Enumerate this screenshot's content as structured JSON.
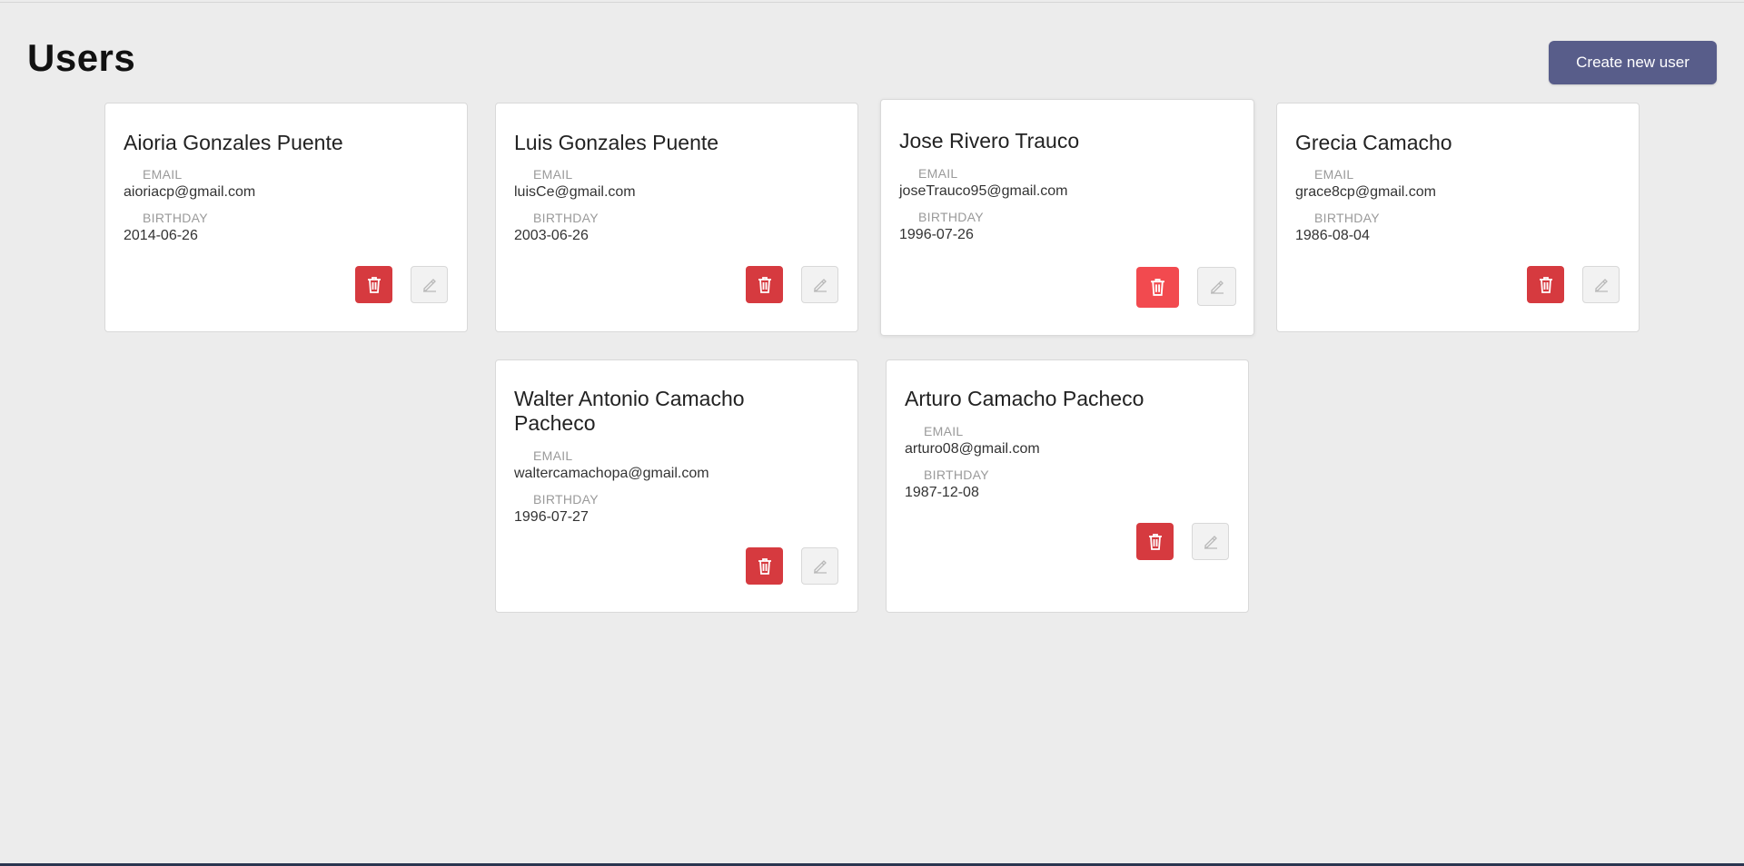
{
  "page": {
    "title": "Users"
  },
  "header": {
    "create_label": "Create new user"
  },
  "labels": {
    "email": "EMAIL",
    "birthday": "BIRTHDAY"
  },
  "icons": {
    "delete": "trash-icon",
    "edit": "pencil-icon"
  },
  "colors": {
    "primary": "#585d8a",
    "danger": "#d63a3f",
    "danger_hover": "#f24a4f",
    "background": "#ececec"
  },
  "users": [
    {
      "name": "Aioria Gonzales Puente",
      "email": "aioriacp@gmail.com",
      "birthday": "2014-06-26"
    },
    {
      "name": "Luis Gonzales Puente",
      "email": "luisCe@gmail.com",
      "birthday": "2003-06-26"
    },
    {
      "name": "Jose Rivero Trauco",
      "email": "joseTrauco95@gmail.com",
      "birthday": "1996-07-26"
    },
    {
      "name": "Grecia Camacho",
      "email": "grace8cp@gmail.com",
      "birthday": "1986-08-04"
    },
    {
      "name": "Walter Antonio Camacho Pacheco",
      "email": "waltercamachopa@gmail.com",
      "birthday": "1996-07-27"
    },
    {
      "name": "Arturo Camacho Pacheco",
      "email": "arturo08@gmail.com",
      "birthday": "1987-12-08"
    }
  ]
}
